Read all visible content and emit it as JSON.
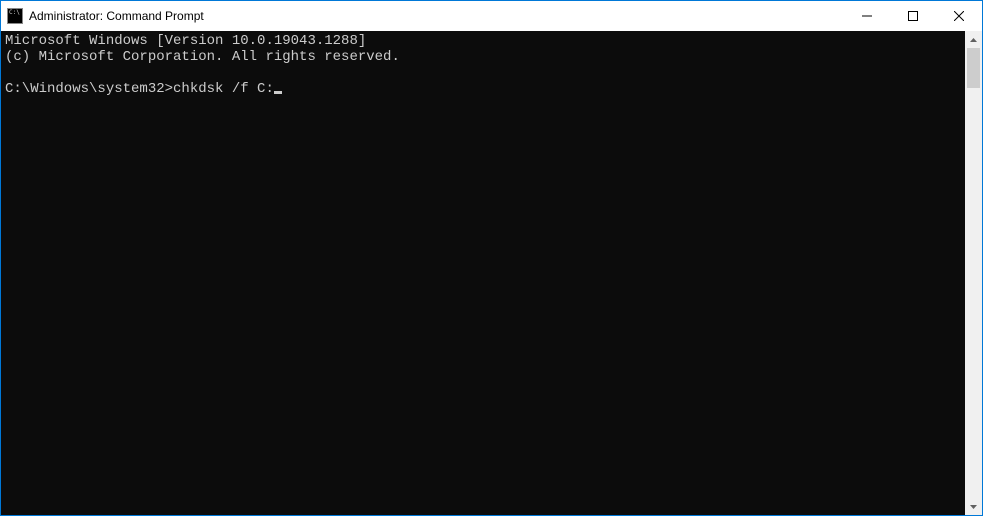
{
  "window": {
    "title": "Administrator: Command Prompt"
  },
  "terminal": {
    "line1": "Microsoft Windows [Version 10.0.19043.1288]",
    "line2": "(c) Microsoft Corporation. All rights reserved.",
    "blank": "",
    "prompt": "C:\\Windows\\system32>",
    "command": "chkdsk /f C:"
  }
}
